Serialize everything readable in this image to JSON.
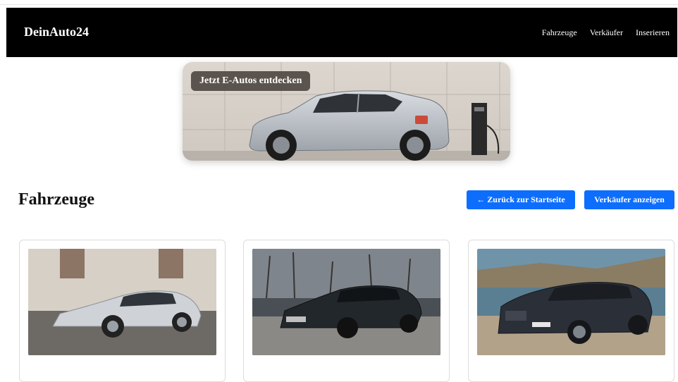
{
  "navbar": {
    "brand": "DeinAuto24",
    "links": [
      "Fahrzeuge",
      "Verkäufer",
      "Inserieren"
    ]
  },
  "hero": {
    "badge": "Jetzt E-Autos entdecken"
  },
  "page": {
    "title": "Fahrzeuge",
    "back_button": "← Zurück zur Startseite",
    "sellers_button": "Verkäufer anzeigen"
  },
  "vehicles": [
    {
      "image": "silver-mercedes-sedan"
    },
    {
      "image": "dark-bmw-sedan"
    },
    {
      "image": "dark-bmw-suv"
    }
  ],
  "colors": {
    "navbar_bg": "#000000",
    "primary_button": "#0d6efd"
  }
}
